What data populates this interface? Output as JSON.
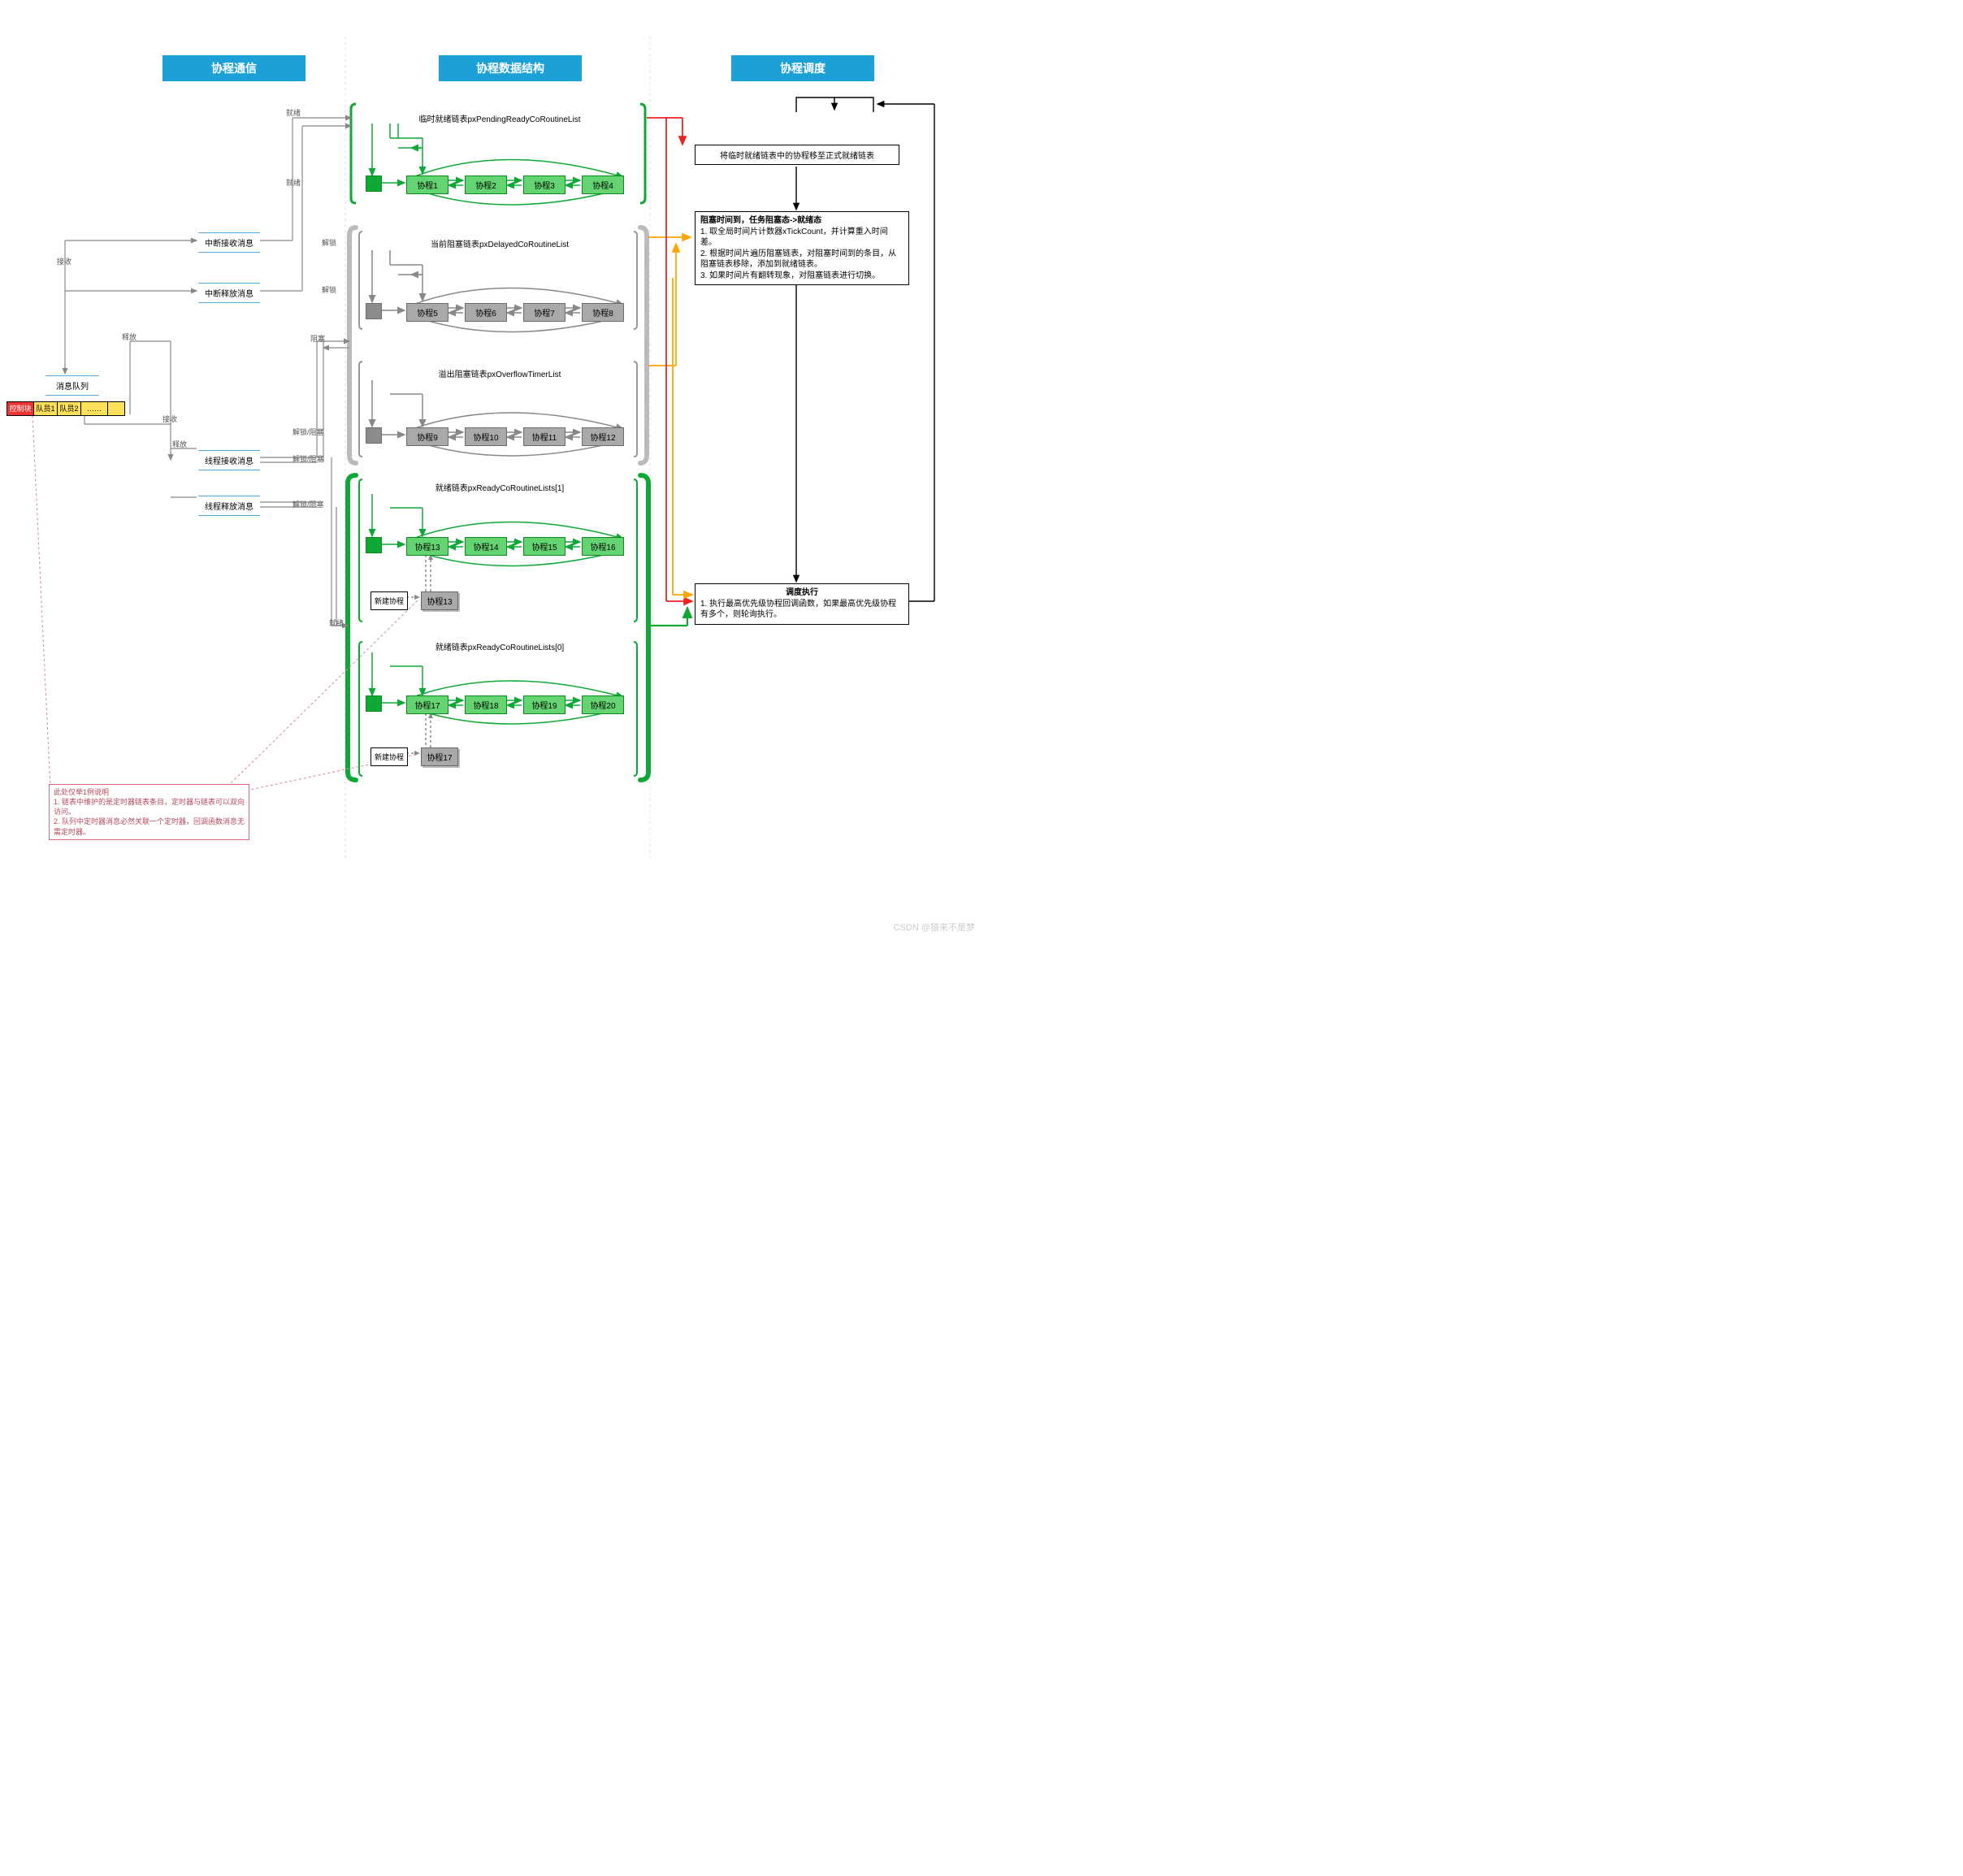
{
  "headers": {
    "comm": "协程通信",
    "data": "协程数据结构",
    "sched": "协程调度"
  },
  "lists": {
    "pending": "临时就绪链表pxPendingReadyCoRoutineList",
    "delayed": "当前阻塞链表pxDelayedCoRoutineList",
    "overflow": "溢出阻塞链表pxOverflowTimerList",
    "ready1": "就绪链表pxReadyCoRoutineLists[1]",
    "ready0": "就绪链表pxReadyCoRoutineLists[0]"
  },
  "nodes": {
    "pending": [
      "协程1",
      "协程2",
      "协程3",
      "协程4"
    ],
    "delayed": [
      "协程5",
      "协程6",
      "协程7",
      "协程8"
    ],
    "overflow": [
      "协程9",
      "协程10",
      "协程11",
      "协程12"
    ],
    "ready1": [
      "协程13",
      "协程14",
      "协程15",
      "协程16"
    ],
    "ready0": [
      "协程17",
      "协程18",
      "协程19",
      "协程20"
    ]
  },
  "new": {
    "label": "新建协程",
    "n13": "协程13",
    "n17": "协程17"
  },
  "msgq": {
    "title": "消息队列",
    "cells": [
      "控制块",
      "队员1",
      "队员2",
      "……",
      "  "
    ]
  },
  "actions": {
    "irq_recv": "中断接收消息",
    "irq_send": "中断释放消息",
    "thr_recv": "线程接收消息",
    "thr_send": "线程释放消息"
  },
  "edges": {
    "ready": "就绪",
    "recv": "接收",
    "send": "释放",
    "block": "阻塞",
    "unlock": "解锁",
    "unlock_block": "解锁/阻塞"
  },
  "sched": {
    "move": "将临时就绪链表中的协程移至正式就绪链表",
    "tick_title": "阻塞时间到，任务阻塞态->就绪态",
    "tick_1": "1. 取全局时间片计数器xTickCount，并计算重入时间差。",
    "tick_2": "2. 根据时间片遍历阻塞链表，对阻塞时间到的条目，从阻塞链表移除，添加到就绪链表。",
    "tick_3": "3. 如果时间片有翻转现象，对阻塞链表进行切换。",
    "exec_title": "调度执行",
    "exec_1": "1. 执行最高优先级协程回调函数，如果最高优先级协程有多个，则轮询执行。"
  },
  "note": {
    "t": "此处仅举1例说明",
    "l1": "1. 链表中维护的是定时器链表条目，定时器与链表可以双向访问。",
    "l2": "2. 队列中定时器消息必然关联一个定时器，回调函数消息无需定时器。"
  },
  "watermark": "CSDN @猿来不是梦"
}
